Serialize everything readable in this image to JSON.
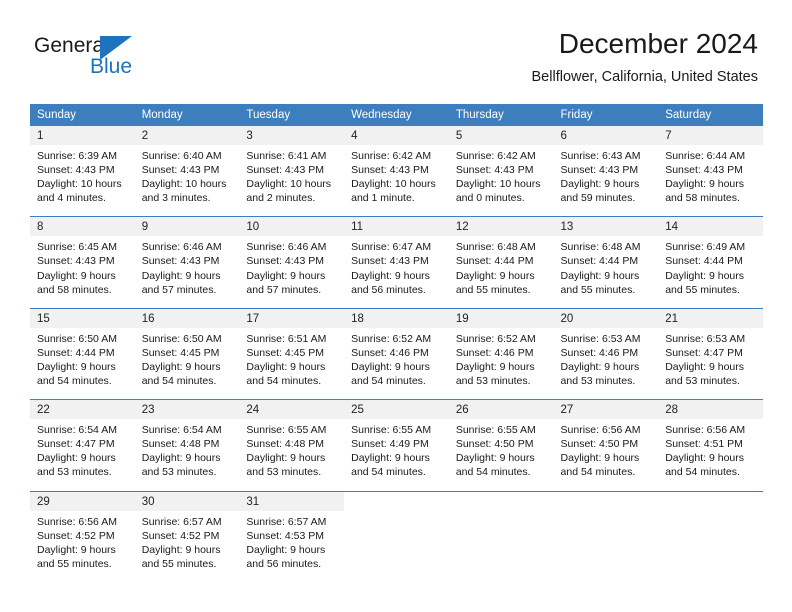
{
  "brand": {
    "name_top": "General",
    "name_bottom": "Blue",
    "accent_color": "#1f72bd"
  },
  "header": {
    "title": "December 2024",
    "subtitle": "Bellflower, California, United States"
  },
  "theme": {
    "header_blue": "#3d7ebe",
    "daynum_gray": "#f1f1f1",
    "text": "#1a1a1a"
  },
  "weekday_headers": [
    "Sunday",
    "Monday",
    "Tuesday",
    "Wednesday",
    "Thursday",
    "Friday",
    "Saturday"
  ],
  "labels": {
    "sunrise_prefix": "Sunrise:",
    "sunset_prefix": "Sunset:",
    "daylight_prefix": "Daylight:"
  },
  "weeks": [
    [
      {
        "day": "1",
        "sunrise": "Sunrise: 6:39 AM",
        "sunset": "Sunset: 4:43 PM",
        "daylight_line1": "Daylight: 10 hours",
        "daylight_line2": "and 4 minutes."
      },
      {
        "day": "2",
        "sunrise": "Sunrise: 6:40 AM",
        "sunset": "Sunset: 4:43 PM",
        "daylight_line1": "Daylight: 10 hours",
        "daylight_line2": "and 3 minutes."
      },
      {
        "day": "3",
        "sunrise": "Sunrise: 6:41 AM",
        "sunset": "Sunset: 4:43 PM",
        "daylight_line1": "Daylight: 10 hours",
        "daylight_line2": "and 2 minutes."
      },
      {
        "day": "4",
        "sunrise": "Sunrise: 6:42 AM",
        "sunset": "Sunset: 4:43 PM",
        "daylight_line1": "Daylight: 10 hours",
        "daylight_line2": "and 1 minute."
      },
      {
        "day": "5",
        "sunrise": "Sunrise: 6:42 AM",
        "sunset": "Sunset: 4:43 PM",
        "daylight_line1": "Daylight: 10 hours",
        "daylight_line2": "and 0 minutes."
      },
      {
        "day": "6",
        "sunrise": "Sunrise: 6:43 AM",
        "sunset": "Sunset: 4:43 PM",
        "daylight_line1": "Daylight: 9 hours",
        "daylight_line2": "and 59 minutes."
      },
      {
        "day": "7",
        "sunrise": "Sunrise: 6:44 AM",
        "sunset": "Sunset: 4:43 PM",
        "daylight_line1": "Daylight: 9 hours",
        "daylight_line2": "and 58 minutes."
      }
    ],
    [
      {
        "day": "8",
        "sunrise": "Sunrise: 6:45 AM",
        "sunset": "Sunset: 4:43 PM",
        "daylight_line1": "Daylight: 9 hours",
        "daylight_line2": "and 58 minutes."
      },
      {
        "day": "9",
        "sunrise": "Sunrise: 6:46 AM",
        "sunset": "Sunset: 4:43 PM",
        "daylight_line1": "Daylight: 9 hours",
        "daylight_line2": "and 57 minutes."
      },
      {
        "day": "10",
        "sunrise": "Sunrise: 6:46 AM",
        "sunset": "Sunset: 4:43 PM",
        "daylight_line1": "Daylight: 9 hours",
        "daylight_line2": "and 57 minutes."
      },
      {
        "day": "11",
        "sunrise": "Sunrise: 6:47 AM",
        "sunset": "Sunset: 4:43 PM",
        "daylight_line1": "Daylight: 9 hours",
        "daylight_line2": "and 56 minutes."
      },
      {
        "day": "12",
        "sunrise": "Sunrise: 6:48 AM",
        "sunset": "Sunset: 4:44 PM",
        "daylight_line1": "Daylight: 9 hours",
        "daylight_line2": "and 55 minutes."
      },
      {
        "day": "13",
        "sunrise": "Sunrise: 6:48 AM",
        "sunset": "Sunset: 4:44 PM",
        "daylight_line1": "Daylight: 9 hours",
        "daylight_line2": "and 55 minutes."
      },
      {
        "day": "14",
        "sunrise": "Sunrise: 6:49 AM",
        "sunset": "Sunset: 4:44 PM",
        "daylight_line1": "Daylight: 9 hours",
        "daylight_line2": "and 55 minutes."
      }
    ],
    [
      {
        "day": "15",
        "sunrise": "Sunrise: 6:50 AM",
        "sunset": "Sunset: 4:44 PM",
        "daylight_line1": "Daylight: 9 hours",
        "daylight_line2": "and 54 minutes."
      },
      {
        "day": "16",
        "sunrise": "Sunrise: 6:50 AM",
        "sunset": "Sunset: 4:45 PM",
        "daylight_line1": "Daylight: 9 hours",
        "daylight_line2": "and 54 minutes."
      },
      {
        "day": "17",
        "sunrise": "Sunrise: 6:51 AM",
        "sunset": "Sunset: 4:45 PM",
        "daylight_line1": "Daylight: 9 hours",
        "daylight_line2": "and 54 minutes."
      },
      {
        "day": "18",
        "sunrise": "Sunrise: 6:52 AM",
        "sunset": "Sunset: 4:46 PM",
        "daylight_line1": "Daylight: 9 hours",
        "daylight_line2": "and 54 minutes."
      },
      {
        "day": "19",
        "sunrise": "Sunrise: 6:52 AM",
        "sunset": "Sunset: 4:46 PM",
        "daylight_line1": "Daylight: 9 hours",
        "daylight_line2": "and 53 minutes."
      },
      {
        "day": "20",
        "sunrise": "Sunrise: 6:53 AM",
        "sunset": "Sunset: 4:46 PM",
        "daylight_line1": "Daylight: 9 hours",
        "daylight_line2": "and 53 minutes."
      },
      {
        "day": "21",
        "sunrise": "Sunrise: 6:53 AM",
        "sunset": "Sunset: 4:47 PM",
        "daylight_line1": "Daylight: 9 hours",
        "daylight_line2": "and 53 minutes."
      }
    ],
    [
      {
        "day": "22",
        "sunrise": "Sunrise: 6:54 AM",
        "sunset": "Sunset: 4:47 PM",
        "daylight_line1": "Daylight: 9 hours",
        "daylight_line2": "and 53 minutes."
      },
      {
        "day": "23",
        "sunrise": "Sunrise: 6:54 AM",
        "sunset": "Sunset: 4:48 PM",
        "daylight_line1": "Daylight: 9 hours",
        "daylight_line2": "and 53 minutes."
      },
      {
        "day": "24",
        "sunrise": "Sunrise: 6:55 AM",
        "sunset": "Sunset: 4:48 PM",
        "daylight_line1": "Daylight: 9 hours",
        "daylight_line2": "and 53 minutes."
      },
      {
        "day": "25",
        "sunrise": "Sunrise: 6:55 AM",
        "sunset": "Sunset: 4:49 PM",
        "daylight_line1": "Daylight: 9 hours",
        "daylight_line2": "and 54 minutes."
      },
      {
        "day": "26",
        "sunrise": "Sunrise: 6:55 AM",
        "sunset": "Sunset: 4:50 PM",
        "daylight_line1": "Daylight: 9 hours",
        "daylight_line2": "and 54 minutes."
      },
      {
        "day": "27",
        "sunrise": "Sunrise: 6:56 AM",
        "sunset": "Sunset: 4:50 PM",
        "daylight_line1": "Daylight: 9 hours",
        "daylight_line2": "and 54 minutes."
      },
      {
        "day": "28",
        "sunrise": "Sunrise: 6:56 AM",
        "sunset": "Sunset: 4:51 PM",
        "daylight_line1": "Daylight: 9 hours",
        "daylight_line2": "and 54 minutes."
      }
    ],
    [
      {
        "day": "29",
        "sunrise": "Sunrise: 6:56 AM",
        "sunset": "Sunset: 4:52 PM",
        "daylight_line1": "Daylight: 9 hours",
        "daylight_line2": "and 55 minutes."
      },
      {
        "day": "30",
        "sunrise": "Sunrise: 6:57 AM",
        "sunset": "Sunset: 4:52 PM",
        "daylight_line1": "Daylight: 9 hours",
        "daylight_line2": "and 55 minutes."
      },
      {
        "day": "31",
        "sunrise": "Sunrise: 6:57 AM",
        "sunset": "Sunset: 4:53 PM",
        "daylight_line1": "Daylight: 9 hours",
        "daylight_line2": "and 56 minutes."
      },
      {
        "day": "",
        "sunrise": "",
        "sunset": "",
        "daylight_line1": "",
        "daylight_line2": ""
      },
      {
        "day": "",
        "sunrise": "",
        "sunset": "",
        "daylight_line1": "",
        "daylight_line2": ""
      },
      {
        "day": "",
        "sunrise": "",
        "sunset": "",
        "daylight_line1": "",
        "daylight_line2": ""
      },
      {
        "day": "",
        "sunrise": "",
        "sunset": "",
        "daylight_line1": "",
        "daylight_line2": ""
      }
    ]
  ]
}
